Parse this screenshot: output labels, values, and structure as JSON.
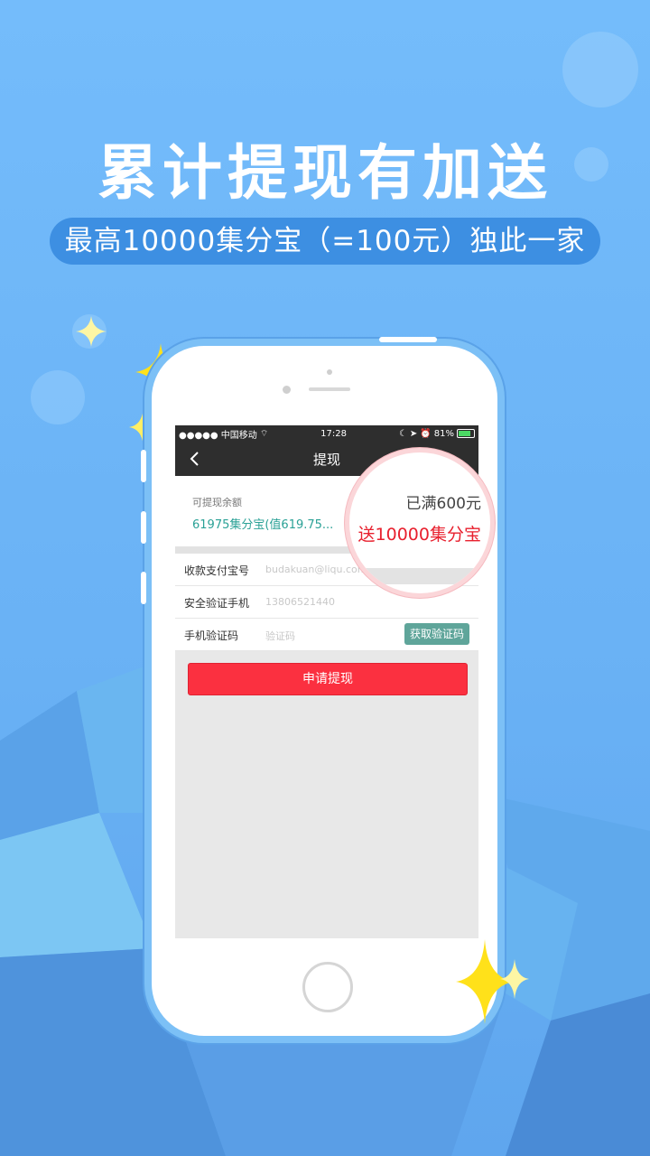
{
  "promo": {
    "headline": "累计提现有加送",
    "subline": "最高10000集分宝（=100元）独此一家"
  },
  "status_bar": {
    "carrier": "●●●●● 中国移动",
    "time": "17:28",
    "battery": "81%"
  },
  "nav": {
    "title": "提现"
  },
  "balance": {
    "label": "可提现余额",
    "value": "61975集分宝(值619.75..."
  },
  "form": {
    "alipay_label": "收款支付宝号",
    "alipay_value": "budakuan@liqu.com",
    "phone_label": "安全验证手机",
    "phone_value": "13806521440",
    "code_label": "手机验证码",
    "code_placeholder": "验证码",
    "get_code_button": "获取验证码"
  },
  "submit_button": "申请提现",
  "callout": {
    "line1": "已满600元",
    "line2": "送10000集分宝"
  },
  "colors": {
    "accent_red": "#fb3040",
    "teal": "#2aa196",
    "background_blue": "#6ab2f5"
  }
}
